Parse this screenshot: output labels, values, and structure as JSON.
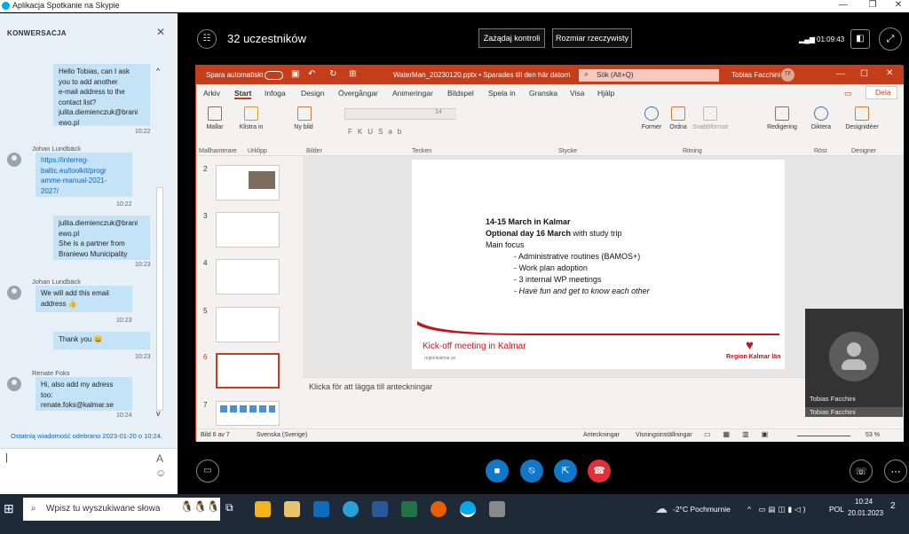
{
  "window": {
    "title": "Aplikacja Spotkanie na Skypie",
    "min": "—",
    "restore": "❐",
    "close": "✕"
  },
  "chat": {
    "header": "KONWERSACJA",
    "close": "✕",
    "messages": [
      {
        "text": [
          "Hello Tobias, can I ask",
          "you to add another",
          "e-mail address to the",
          "contact list?",
          "julita.diemienczuk@brani",
          "ewo.pl"
        ],
        "time": "10:22"
      },
      {
        "sender": "Johan Lundbäck",
        "text": [
          "https://interreg-",
          "baltic.eu/toolkit/progr",
          "amme-manual-2021-",
          "2027/"
        ],
        "time": "10:22"
      },
      {
        "text": [
          "julita.diemienczuk@brani",
          "ewo.pl",
          "She is a partner from",
          "Braniewo Municipality"
        ],
        "time": "10:23"
      },
      {
        "sender": "Johan Lundbäck",
        "text": [
          "We will add this email",
          "address 👍"
        ],
        "time": "10:23"
      },
      {
        "text": [
          "Thank you 😀"
        ],
        "time": "10:23"
      },
      {
        "sender": "Renate Foks",
        "text": [
          "Hi, also add my adress",
          "too:",
          "renate.foks@kalmar.se"
        ],
        "time": "10:24"
      }
    ],
    "last_received": "Ostatnią wiadomość odebrano 2023-01-20 o 10:24.",
    "compose_cursor": "|",
    "font_icon": "A",
    "emoji_icon": "☺"
  },
  "call": {
    "participants": "32 uczestników",
    "request_control": "Zażądaj kontroli",
    "actual_size": "Rozmiar rzeczywisty",
    "timer": "01:09:43"
  },
  "ppt": {
    "autosave": "Spara automatiskt",
    "filename": "WaterMan_20230120.pptx • Sparades till den här datorn",
    "search": "Sök (Alt+Q)",
    "user": "Tobias Facchini",
    "user_initials": "TF",
    "tabs": [
      "Arkiv",
      "Start",
      "Infoga",
      "Design",
      "Övergångar",
      "Animeringar",
      "Bildspel",
      "Spela in",
      "Granska",
      "Visa",
      "Hjälp"
    ],
    "share": "Dela",
    "ribbon": {
      "mallar": "Mallar",
      "klistra": "Klistra in",
      "ny_bild": "Ny bild",
      "font_size": "14",
      "former": "Former",
      "ordna": "Ordna",
      "snabbformat": "Snabbformat",
      "redigering": "Redigering",
      "diktera": "Diktera",
      "designideer": "Designidéer",
      "groups": [
        "Mallhanterare",
        "Urklipp",
        "Bilder",
        "Tecken",
        "Stycke",
        "Ritning",
        "Röst",
        "Designer"
      ]
    },
    "thumb_numbers": [
      "2",
      "3",
      "4",
      "5",
      "6",
      "7"
    ],
    "slide": {
      "line1": "14-15 March in Kalmar",
      "line2_bold": "Optional day 16 March",
      "line2_rest": " with study trip",
      "line3": "Main focus",
      "bullets": [
        "- Administrative routines (BAMOS+)",
        "- Work plan adoption",
        "- 3 internal WP meetings"
      ],
      "bullet_italic": "- Have fun and get to know each other",
      "footer": "Kick-off meeting in Kalmar",
      "small": "regionkalmar.se",
      "logo": "Region Kalmar län"
    },
    "notes": "Klicka för att lägga till anteckningar",
    "status": {
      "slide": "Bild 6 av 7",
      "lang": "Svenska (Sverige)",
      "notes": "Anteckningar",
      "view": "Visningsinställningar",
      "zoom": "53 %"
    }
  },
  "video": {
    "name": "Tobias Facchini",
    "name_bar": "Tobias Facchini"
  },
  "taskbar": {
    "search": "Wpisz tu wyszukiwane słowa",
    "weather": "-2°C  Pochmurnie",
    "lang": "POL",
    "time": "10:24",
    "date": "20.01.2023",
    "notif": "2"
  }
}
